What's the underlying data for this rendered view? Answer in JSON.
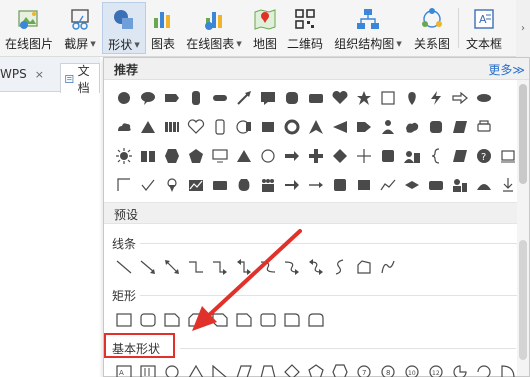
{
  "ribbon": {
    "buttons": [
      {
        "label": "在线图片",
        "icon": "online-picture-icon",
        "dropdown": false
      },
      {
        "label": "截屏",
        "icon": "screenshot-icon",
        "dropdown": true
      },
      {
        "label": "形状",
        "icon": "shapes-icon",
        "dropdown": true,
        "active": true
      },
      {
        "label": "图表",
        "icon": "chart-icon",
        "dropdown": false
      },
      {
        "label": "在线图表",
        "icon": "online-chart-icon",
        "dropdown": true
      },
      {
        "label": "地图",
        "icon": "map-icon",
        "dropdown": false
      },
      {
        "label": "二维码",
        "icon": "qr-code-icon",
        "dropdown": false
      },
      {
        "label": "组织结构图",
        "icon": "org-chart-icon",
        "dropdown": true
      },
      {
        "label": "关系图",
        "icon": "relation-diagram-icon",
        "dropdown": false
      },
      {
        "label": "文本框",
        "icon": "text-box-icon",
        "dropdown": false
      }
    ],
    "dropdown_glyph": "▼",
    "scroll_glyph": "›"
  },
  "tabs": [
    {
      "label": "WPS",
      "close": "×"
    },
    {
      "label": "文档"
    }
  ],
  "panel": {
    "recommended_title": "推荐",
    "more_link": "更多≫",
    "preset_title": "预设",
    "sections": {
      "lines": "线条",
      "rectangles": "矩形",
      "basic_shapes": "基本形状"
    }
  },
  "colors": {
    "accent": "#2a6ec9",
    "highlight": "#e0312a",
    "icon_gray": "#4a4a4a"
  }
}
